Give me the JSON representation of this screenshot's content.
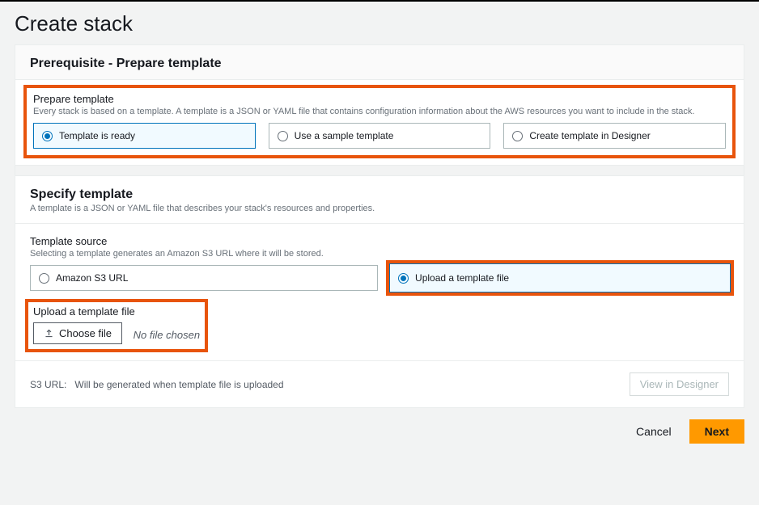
{
  "page": {
    "title": "Create stack"
  },
  "prereq": {
    "header": "Prerequisite - Prepare template",
    "prepare": {
      "label": "Prepare template",
      "desc": "Every stack is based on a template. A template is a JSON or YAML file that contains configuration information about the AWS resources you want to include in the stack.",
      "options": {
        "ready": "Template is ready",
        "sample": "Use a sample template",
        "designer": "Create template in Designer"
      }
    }
  },
  "specify": {
    "header": "Specify template",
    "desc": "A template is a JSON or YAML file that describes your stack's resources and properties.",
    "source": {
      "label": "Template source",
      "desc": "Selecting a template generates an Amazon S3 URL where it will be stored.",
      "options": {
        "s3url": "Amazon S3 URL",
        "upload": "Upload a template file"
      }
    },
    "upload": {
      "label": "Upload a template file",
      "button": "Choose file",
      "status": "No file chosen"
    }
  },
  "s3": {
    "label": "S3 URL:",
    "value": "Will be generated when template file is uploaded",
    "viewDesigner": "View in Designer"
  },
  "footer": {
    "cancel": "Cancel",
    "next": "Next"
  }
}
